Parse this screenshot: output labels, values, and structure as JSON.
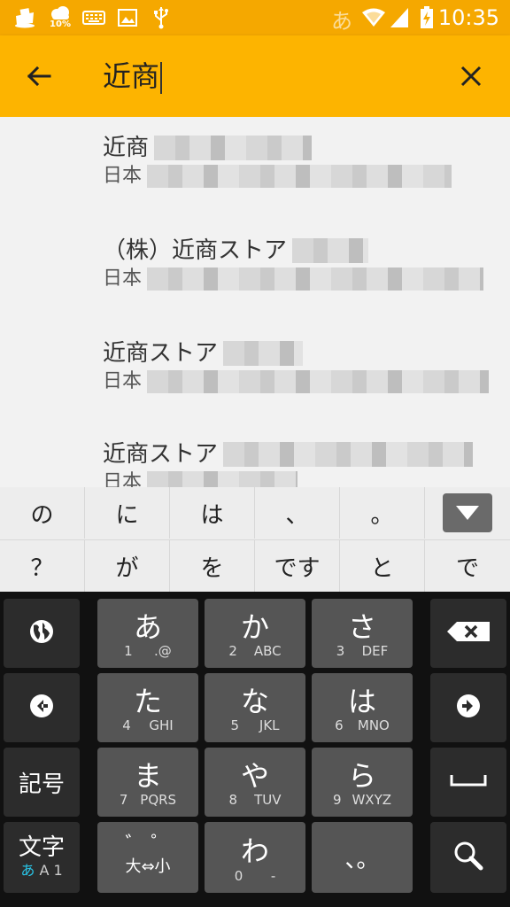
{
  "status_bar": {
    "ime_indicator": "あ",
    "time": "10:35",
    "weather_percent": "10%",
    "icons": [
      "tray-icon",
      "weather-cloud-icon",
      "keyboard-icon",
      "image-icon",
      "usb-icon",
      "wifi-icon",
      "signal-icon",
      "battery-charging-icon"
    ]
  },
  "search": {
    "query": "近商",
    "back_icon": "arrow-left-icon",
    "clear_icon": "close-icon"
  },
  "results": [
    {
      "title": "近商",
      "subtitle": "日本"
    },
    {
      "title": "（株）近商ストア",
      "subtitle": "日本"
    },
    {
      "title": "近商ストア",
      "subtitle": "日本"
    },
    {
      "title": "近商ストア",
      "subtitle": "日本"
    }
  ],
  "suggestions": {
    "row1": [
      "の",
      "に",
      "は",
      "、",
      "。"
    ],
    "row2": [
      "？",
      "が",
      "を",
      "です",
      "と",
      "で"
    ]
  },
  "keyboard": {
    "keys": [
      {
        "main": "あ",
        "num": "1",
        "alt": ".@"
      },
      {
        "main": "か",
        "num": "2",
        "alt": "ABC"
      },
      {
        "main": "さ",
        "num": "3",
        "alt": "DEF"
      },
      {
        "main": "た",
        "num": "4",
        "alt": "GHI"
      },
      {
        "main": "な",
        "num": "5",
        "alt": "JKL"
      },
      {
        "main": "は",
        "num": "6",
        "alt": "MNO"
      },
      {
        "main": "ま",
        "num": "7",
        "alt": "PQRS"
      },
      {
        "main": "や",
        "num": "8",
        "alt": "TUV"
      },
      {
        "main": "ら",
        "num": "9",
        "alt": "WXYZ"
      },
      {
        "main": "わ",
        "num": "0",
        "alt": "-"
      }
    ],
    "dakuten_top": "゛ ゜",
    "dakuten_bottom": "大⇔小",
    "punct": "、。",
    "symbols_label": "記号",
    "mode_label": "文字",
    "mode_sub_kana": "あ",
    "mode_sub_rest": "A 1"
  },
  "colors": {
    "status_bar": "#f5a800",
    "search_bar": "#fdb400",
    "keyboard_bg": "#111111",
    "key_main": "#555555",
    "key_func": "#2c2c2c",
    "mode_accent": "#29c6e8"
  }
}
